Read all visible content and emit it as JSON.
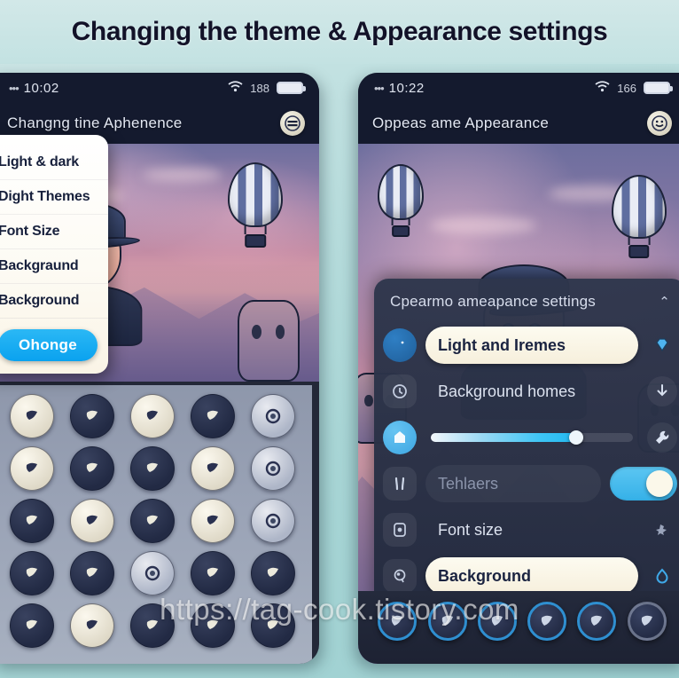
{
  "title": "Changing the theme & Appearance settings",
  "watermark": "https://tag-cook.tistory.com",
  "left_phone": {
    "status": {
      "dots": "•••",
      "time": "10:02",
      "signal_value": "188",
      "wifi_icon": "wifi-icon",
      "battery_icon": "battery-icon"
    },
    "appbar": {
      "title": "Changng tine Aphenence",
      "avatar_icon": "avatar-icon"
    },
    "dropdown": {
      "items": [
        {
          "label": "Light & dark"
        },
        {
          "label": "Dight Themes"
        },
        {
          "label": "Font Size"
        },
        {
          "label": "Backgraund"
        },
        {
          "label": "Background"
        }
      ],
      "button_label": "Ohonge"
    },
    "app_grid": {
      "icons": [
        {
          "name": "face-icon",
          "style": "light"
        },
        {
          "name": "flag-icon",
          "style": "dark"
        },
        {
          "name": "ghost-icon",
          "style": "light"
        },
        {
          "name": "hand-icon",
          "style": "dark"
        },
        {
          "name": "target-icon",
          "style": "ring"
        },
        {
          "name": "bell-icon",
          "style": "light"
        },
        {
          "name": "bookmark-icon",
          "style": "dark"
        },
        {
          "name": "cloud-icon",
          "style": "dark"
        },
        {
          "name": "blob-icon",
          "style": "light"
        },
        {
          "name": "circle-icon",
          "style": "ring"
        },
        {
          "name": "megaphone-icon",
          "style": "dark"
        },
        {
          "name": "cat-icon",
          "style": "light"
        },
        {
          "name": "paw-icon",
          "style": "dark"
        },
        {
          "name": "pig-icon",
          "style": "light"
        },
        {
          "name": "camera-icon",
          "style": "ring"
        },
        {
          "name": "map-icon",
          "style": "dark"
        },
        {
          "name": "leaf-icon",
          "style": "dark"
        },
        {
          "name": "ring-icon",
          "style": "ring"
        },
        {
          "name": "shell-icon",
          "style": "dark"
        },
        {
          "name": "eyes-icon",
          "style": "dark"
        },
        {
          "name": "lock-icon",
          "style": "dark"
        },
        {
          "name": "fox-icon",
          "style": "light"
        },
        {
          "name": "bone-icon",
          "style": "dark"
        },
        {
          "name": "scissors-icon",
          "style": "dark"
        },
        {
          "name": "mask-icon",
          "style": "dark"
        }
      ]
    }
  },
  "right_phone": {
    "status": {
      "dots": "•••",
      "time": "10:22",
      "signal_value": "166",
      "wifi_icon": "wifi-icon",
      "battery_icon": "battery-icon"
    },
    "appbar": {
      "title": "Oppeas ame Appearance",
      "avatar_icon": "avatar-icon"
    },
    "settings": {
      "header": "Cpearmo ameapance  settings",
      "chevron": "⌃",
      "rows": [
        {
          "label": "Light and Iremes",
          "icon": "theme-icon",
          "trail_icon": "gem-icon",
          "type": "pill"
        },
        {
          "label": "Background homes",
          "icon": "clock-icon",
          "trail_icon": "download-icon",
          "type": "plain"
        },
        {
          "label": "",
          "icon": "brightness-icon",
          "trail_icon": "wrench-icon",
          "type": "slider",
          "value": 72
        },
        {
          "label": "Tehlaers",
          "icon": "contrast-icon",
          "trail_icon": "toggle-icon",
          "type": "toggle",
          "enabled": true
        },
        {
          "label": "Font size",
          "icon": "font-icon",
          "trail_icon": "pin-icon",
          "type": "plain"
        },
        {
          "label": "Background",
          "icon": "wallpaper-icon",
          "trail_icon": "droplet-icon",
          "type": "pill"
        }
      ]
    },
    "bottom_nav": {
      "items": [
        {
          "name": "nav-home-icon"
        },
        {
          "name": "nav-shield-icon"
        },
        {
          "name": "nav-lens-icon"
        },
        {
          "name": "nav-check-icon"
        },
        {
          "name": "nav-heart-icon"
        },
        {
          "name": "nav-power-icon"
        }
      ]
    }
  },
  "colors": {
    "background": "#a9d6d6",
    "phone_dark": "#232838",
    "statusbar": "#141a2e",
    "accent_blue": "#35b1e8",
    "cream_pill": "#fdfbf0",
    "title_text": "#121228"
  }
}
